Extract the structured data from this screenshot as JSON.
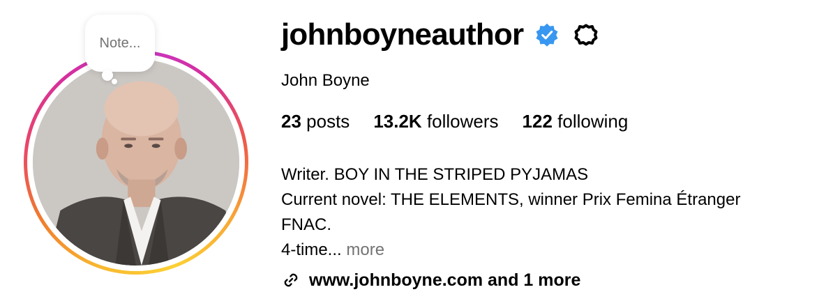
{
  "profile": {
    "username": "johnboyneauthor",
    "full_name": "John Boyne",
    "verified": true,
    "note_placeholder": "Note...",
    "stats": {
      "posts_count": "23",
      "posts_label": "posts",
      "followers_count": "13.2K",
      "followers_label": "followers",
      "following_count": "122",
      "following_label": "following"
    },
    "bio": {
      "line1": "Writer. BOY IN THE STRIPED PYJAMAS",
      "line2": "Current novel: THE ELEMENTS, winner Prix Femina Étranger",
      "line3": "FNAC.",
      "line4": "4-time...",
      "more_label": "more"
    },
    "link": {
      "text": "www.johnboyne.com and 1 more",
      "icon": "link-icon"
    }
  },
  "icons": {
    "verified": "verified-badge-icon",
    "options": "options-gear-icon"
  },
  "colors": {
    "verified_blue": "#3897f0",
    "muted_text": "#737373",
    "ring_gradient": [
      "#fcd134",
      "#f07a2e",
      "#e8456a",
      "#c638c8"
    ]
  }
}
